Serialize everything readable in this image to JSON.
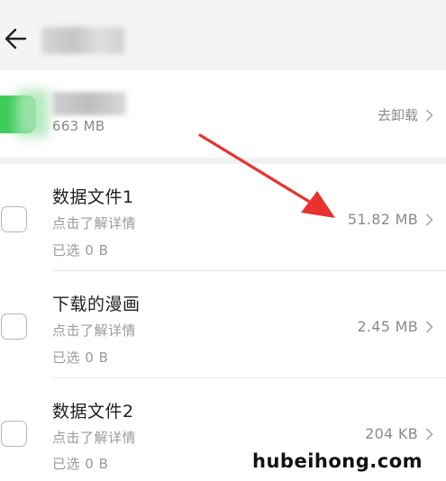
{
  "header": {
    "title_blurred": ""
  },
  "app": {
    "size": "663 MB",
    "uninstall_label": "去卸载"
  },
  "items": [
    {
      "title": "数据文件1",
      "detail": "点击了解详情",
      "selected": "已选 0 B",
      "size": "51.82 MB"
    },
    {
      "title": "下载的漫画",
      "detail": "点击了解详情",
      "selected": "已选 0 B",
      "size": "2.45 MB"
    },
    {
      "title": "数据文件2",
      "detail": "点击了解详情",
      "selected": "已选 0 B",
      "size": "204 KB"
    }
  ],
  "annotation": {
    "arrow_color": "#e8322e"
  },
  "watermark": "hubeihong.com",
  "colors": {
    "header_bg": "#f4f4f4",
    "app_icon": "#3dcc5a",
    "secondary_text": "#9a9a9a"
  }
}
